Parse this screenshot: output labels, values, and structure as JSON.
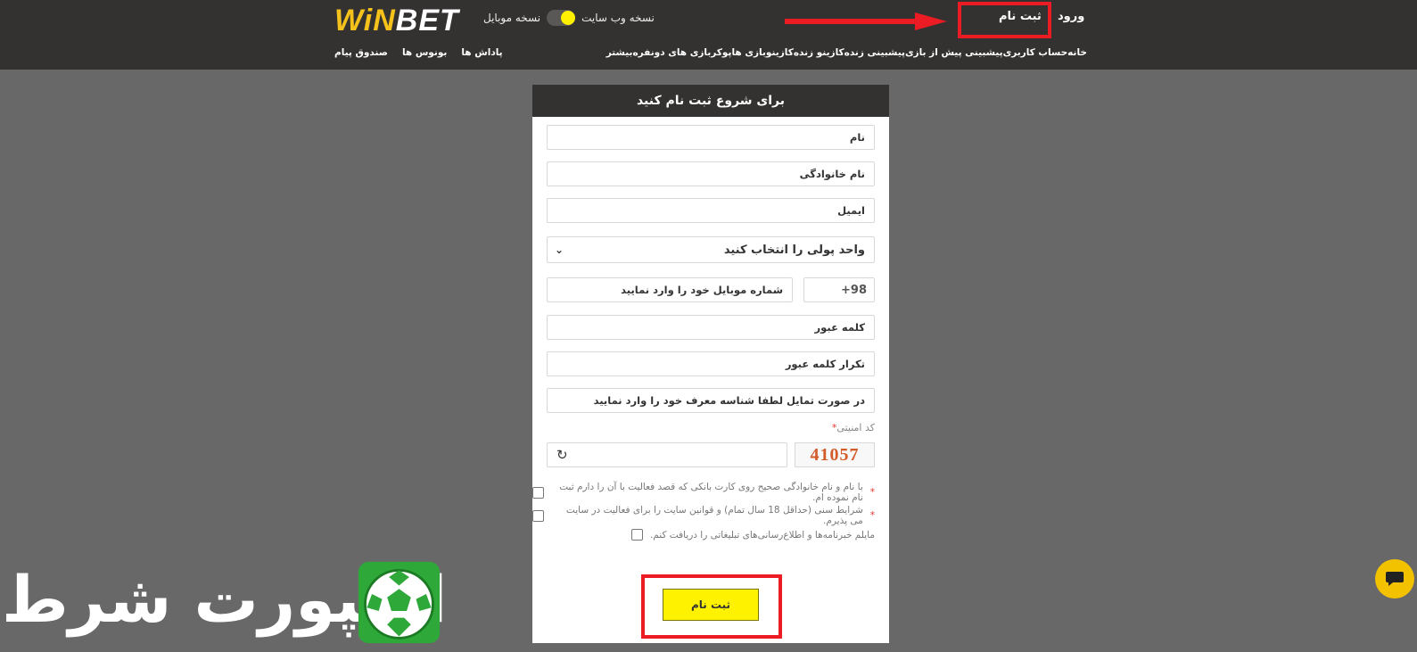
{
  "header": {
    "logo_win": "WiN",
    "logo_bet": "BET",
    "web_version": "نسخه وب سایت",
    "mobile_version": "نسخه موبایل",
    "login": "ورود",
    "signup": "ثبت نام"
  },
  "nav": {
    "items": [
      "خانه",
      "حساب کاربری",
      "پیشبینی پیش از بازی",
      "پیشبینی زنده",
      "کازینو زنده",
      "کازینو",
      "بازی ها",
      "پوکر",
      "بازی های دونفره",
      "بیشتر"
    ],
    "secondary": [
      "پاداش ها",
      "بونوس ها",
      "صندوق پیام"
    ]
  },
  "form": {
    "title": "برای شروع ثبت نام کنید",
    "first_name": "نام",
    "last_name": "نام خانوادگی",
    "email": "ایمیل",
    "currency": "واحد پولی را انتخاب کنید",
    "phone_code": "+98",
    "phone": "شماره موبایل خود را وارد نمایید",
    "password": "کلمه عبور",
    "password_repeat": "تکرار کلمه عبور",
    "referral": "در صورت تمایل لطفا شناسه معرف خود را وارد نمایید",
    "security_label": "کد امنیتی",
    "captcha_value": "41057",
    "check1": "با نام و نام خانوادگی صحیح روی کارت بانکی که قصد فعالیت با آن را دارم ثبت نام نموده ام.",
    "check2": "شرایط سنی (حداقل 18 سال تمام) و قوانین سایت را برای فعالیت در سایت می پذیرم.",
    "check3": "مایلم خبرنامه‌ها و اطلاع‌رسانی‌های تبلیغاتی را دریافت کنم.",
    "submit": "ثبت نام"
  },
  "watermark": {
    "text": "اسپورت شرط"
  },
  "colors": {
    "header_bg": "#343231",
    "page_bg": "#686868",
    "accent_yellow": "#fff200",
    "highlight_red": "#ec1c24",
    "chat_yellow": "#f2c100"
  }
}
